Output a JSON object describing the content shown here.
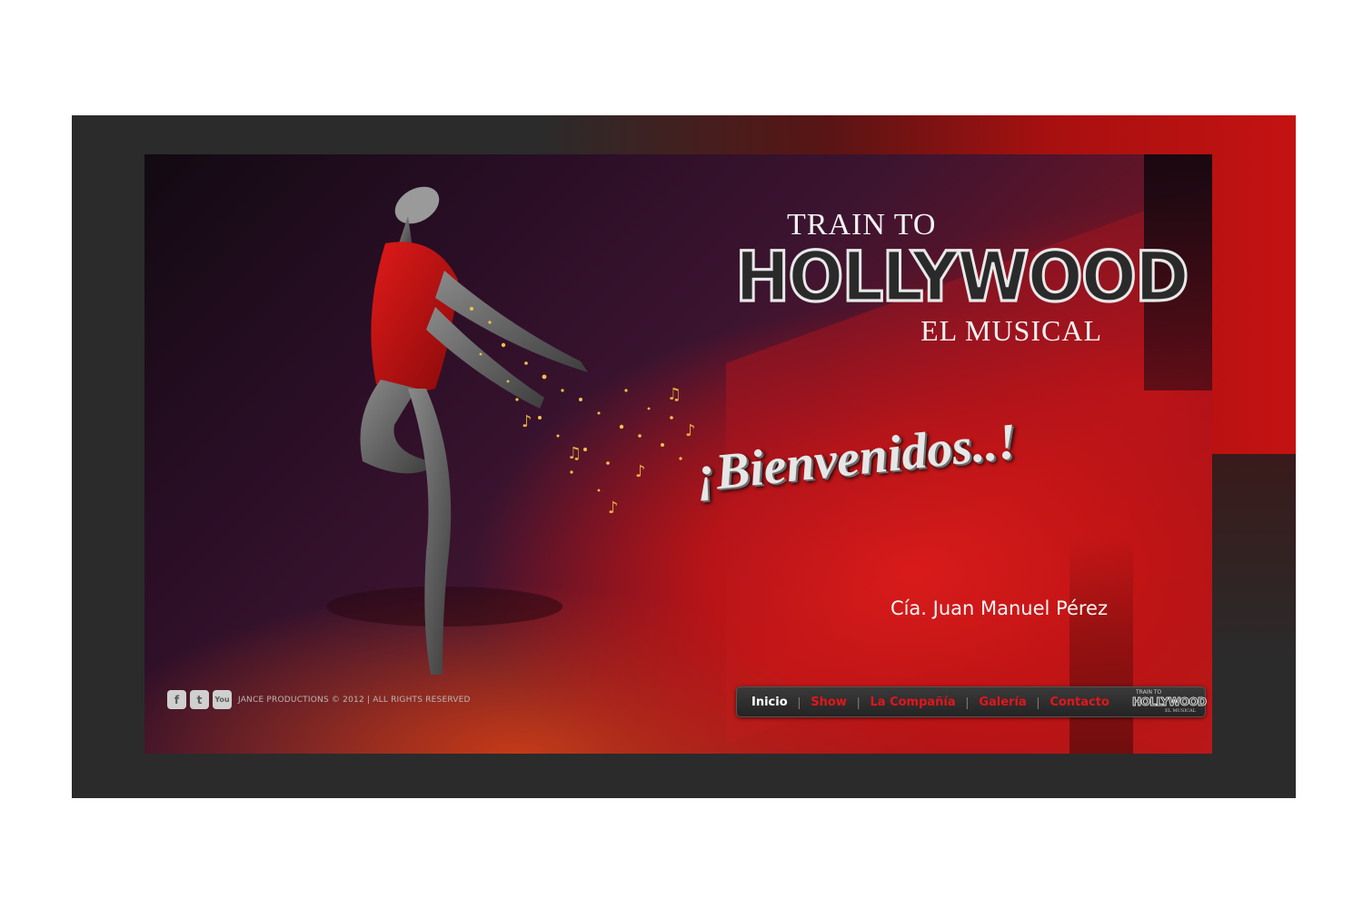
{
  "hero": {
    "logo_line1": "TRAIN TO",
    "logo_line2": "HOLLYWOOD",
    "logo_line3": "EL MUSICAL",
    "welcome": "¡Bienvenidos..!",
    "company": "Cía. Juan Manuel Pérez"
  },
  "footer": {
    "social": [
      {
        "icon": "facebook-icon",
        "glyph": "f"
      },
      {
        "icon": "twitter-icon",
        "glyph": "t"
      },
      {
        "icon": "youtube-icon",
        "glyph": "You"
      }
    ],
    "copyright": "JANCE PRODUCTIONS © 2012 | ALL RIGHTS RESERVED"
  },
  "nav": {
    "items": [
      {
        "label": "Inicio",
        "active": true
      },
      {
        "label": "Show",
        "active": false
      },
      {
        "label": "La Compañía",
        "active": false
      },
      {
        "label": "Galería",
        "active": false
      },
      {
        "label": "Contacto",
        "active": false
      }
    ],
    "mini_logo": {
      "line1": "TRAIN TO",
      "line2": "HOLLYWOOD",
      "line3": "EL MUSICAL"
    }
  },
  "colors": {
    "accent": "#e8141a",
    "nav_active": "#ffffff",
    "frame_dark": "#2b2b2b"
  }
}
